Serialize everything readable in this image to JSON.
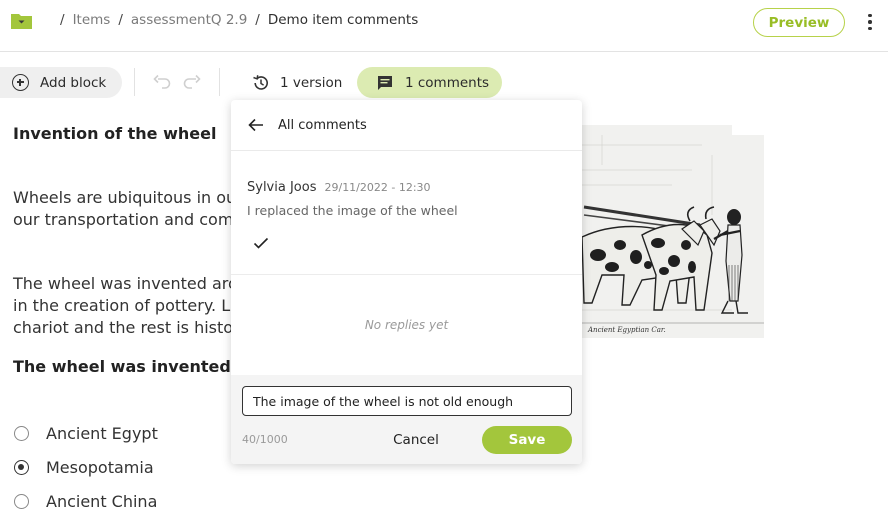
{
  "breadcrumb": {
    "items": [
      "Items",
      "assessmentQ 2.9",
      "Demo item comments"
    ],
    "separator": "/"
  },
  "header": {
    "preview_label": "Preview",
    "icons": [
      "folder-icon",
      "chevron-down-icon",
      "more-vertical-icon"
    ]
  },
  "toolbar": {
    "add_block_label": "Add block",
    "version_label": "1 version",
    "comments_label": "1 comments",
    "icons": [
      "plus-circle-icon",
      "undo-icon",
      "redo-icon",
      "history-icon",
      "comment-icon"
    ]
  },
  "content": {
    "title": "Invention of the wheel",
    "paragraph1": [
      "Wheels are ubiquitous in our",
      "our transportation and comm"
    ],
    "paragraph2": [
      "The wheel was invented arou",
      "in the creation of pottery. Lat",
      "chariot and the rest is history"
    ],
    "question": "The wheel was invented in:",
    "options": [
      {
        "label": "Ancient Egypt",
        "checked": false
      },
      {
        "label": "Mesopotamia",
        "checked": true
      },
      {
        "label": "Ancient China",
        "checked": false
      }
    ],
    "image_caption": "Ancient Egyptian Car."
  },
  "comments_panel": {
    "back_label": "All comments",
    "comment": {
      "author": "Sylvia Joos",
      "date": "29/11/2022 - 12:30",
      "text": "I replaced the image of the wheel"
    },
    "no_replies": "No replies yet",
    "reply_value": "The image of the wheel is not old enough",
    "counter": "40/1000",
    "cancel_label": "Cancel",
    "save_label": "Save"
  },
  "colors": {
    "accent": "#a3c63c",
    "accent_light": "#dcebb2",
    "folder": "#a3c63c"
  }
}
